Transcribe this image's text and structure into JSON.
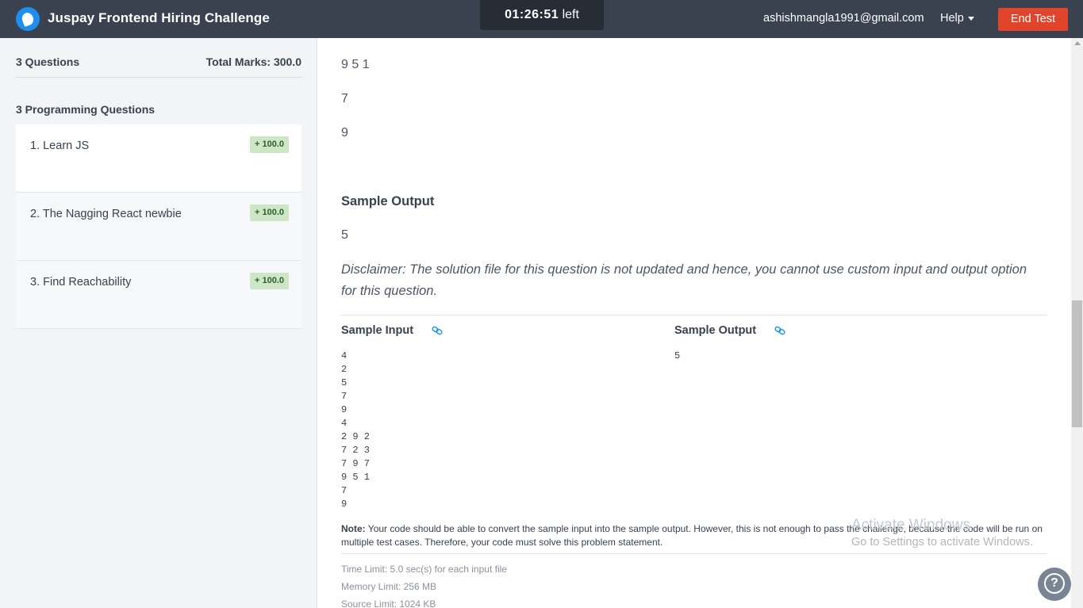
{
  "header": {
    "title": "Juspay Frontend Hiring Challenge",
    "timer": {
      "time": "01:26:51",
      "suffix": "left"
    },
    "email": "ashishmangla1991@gmail.com",
    "help_label": "Help",
    "end_test_label": "End Test"
  },
  "sidebar": {
    "questions_count": "3 Questions",
    "total_marks": "Total Marks: 300.0",
    "section_title": "3 Programming Questions",
    "questions": [
      {
        "label": "1. Learn JS",
        "marks": "+ 100.0"
      },
      {
        "label": "2. The Nagging React newbie",
        "marks": "+ 100.0"
      },
      {
        "label": "3. Find Reachability",
        "marks": "+ 100.0"
      }
    ]
  },
  "problem": {
    "input_tail": [
      "9 5 1",
      "7",
      "9"
    ],
    "sample_output_title": "Sample Output",
    "sample_output_value": "5",
    "disclaimer": "Disclaimer: The solution file for this question is not updated and hence, you cannot use custom input and output option for this question.",
    "sample_input_label": "Sample Input",
    "sample_input_text": "4\n2\n5\n7\n9\n4\n2 9 2\n7 2 3\n7 9 7\n9 5 1\n7\n9",
    "sample_output_label": "Sample Output",
    "sample_output_text": "5",
    "note_label": "Note:",
    "note_text": "Your code should be able to convert the sample input into the sample output. However, this is not enough to pass the challenge, because the code will be run on multiple test cases. Therefore, your code must solve this problem statement.",
    "time_limit": "Time Limit: 5.0 sec(s) for each input file",
    "memory_limit": "Memory Limit: 256 MB",
    "source_limit": "Source Limit: 1024 KB"
  },
  "watermark": {
    "line1": "Activate Windows",
    "line2": "Go to Settings to activate Windows."
  },
  "colors": {
    "header_bg": "#39424e",
    "end_test": "#e0452c",
    "marks_badge": "#cde6c6",
    "link_icon": "#1f8ef1"
  }
}
